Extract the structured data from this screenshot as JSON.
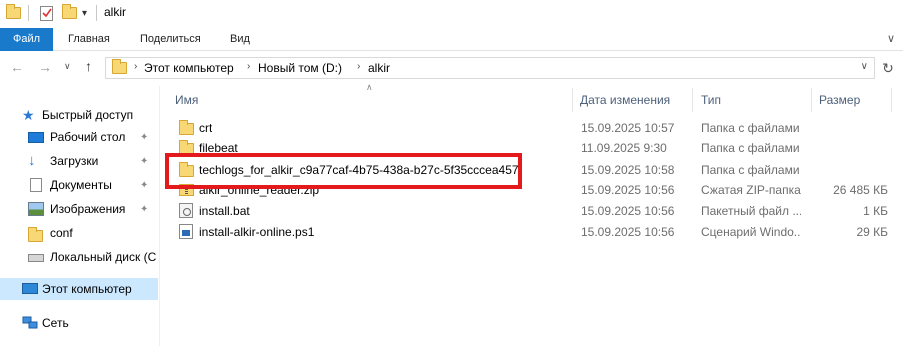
{
  "window": {
    "title": "alkir"
  },
  "ribbon": {
    "tabs": [
      {
        "label": "Файл"
      },
      {
        "label": "Главная"
      },
      {
        "label": "Поделиться"
      },
      {
        "label": "Вид"
      }
    ]
  },
  "address": {
    "crumbs": [
      {
        "label": "Этот компьютер"
      },
      {
        "label": "Новый том (D:)"
      },
      {
        "label": "alkir"
      }
    ]
  },
  "navpane": {
    "items": [
      {
        "label": "Быстрый доступ",
        "icon": "star-icon"
      },
      {
        "label": "Рабочий стол",
        "icon": "desktop-icon",
        "pinned": true
      },
      {
        "label": "Загрузки",
        "icon": "download-icon",
        "pinned": true
      },
      {
        "label": "Документы",
        "icon": "documents-icon",
        "pinned": true
      },
      {
        "label": "Изображения",
        "icon": "pictures-icon",
        "pinned": true
      },
      {
        "label": "conf",
        "icon": "folder-icon"
      },
      {
        "label": "Локальный диск (C",
        "icon": "drive-icon"
      },
      {
        "label": "Этот компьютер",
        "icon": "computer-icon",
        "selected": true
      },
      {
        "label": "Сеть",
        "icon": "network-icon"
      }
    ]
  },
  "columns": {
    "name": "Имя",
    "date": "Дата изменения",
    "type": "Тип",
    "size": "Размер"
  },
  "files": [
    {
      "name": "crt",
      "date": "15.09.2025 10:57",
      "type": "Папка с файлами",
      "size": "",
      "icon": "folder-icon"
    },
    {
      "name": "filebeat",
      "date": "11.09.2025 9:30",
      "type": "Папка с файлами",
      "size": "",
      "icon": "folder-icon"
    },
    {
      "name": "techlogs_for_alkir_c9a77caf-4b75-438a-b27c-5f35cccea457",
      "date": "15.09.2025 10:58",
      "type": "Папка с файлами",
      "size": "",
      "icon": "folder-icon"
    },
    {
      "name": "alkir_online_reader.zip",
      "date": "15.09.2025 10:56",
      "type": "Сжатая ZIP-папка",
      "size": "26 485 КБ",
      "icon": "zip-icon"
    },
    {
      "name": "install.bat",
      "date": "15.09.2025 10:56",
      "type": "Пакетный файл ...",
      "size": "1 КБ",
      "icon": "bat-icon"
    },
    {
      "name": "install-alkir-online.ps1",
      "date": "15.09.2025 10:56",
      "type": "Сценарий Windo...",
      "size": "29 КБ",
      "icon": "script-icon"
    }
  ],
  "colors": {
    "file_tab": "#1979ca",
    "selection": "#cce8ff",
    "highlight": "#e3191b"
  }
}
